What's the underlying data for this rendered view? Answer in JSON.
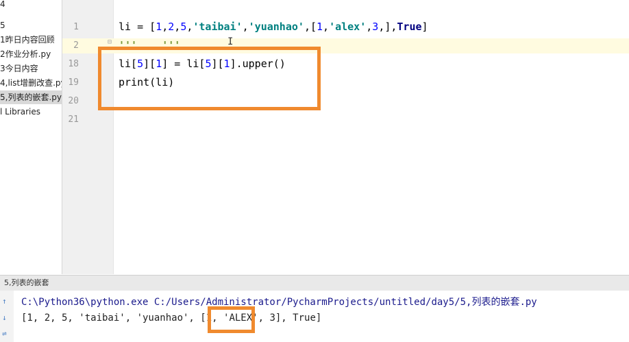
{
  "sidebar": {
    "items": [
      {
        "label": "4"
      },
      {
        "label": "5"
      },
      {
        "label": "1昨日内容回顾"
      },
      {
        "label": "2作业分析.py"
      },
      {
        "label": "3今日内容"
      },
      {
        "label": "4,list增删改查.py"
      },
      {
        "label": "5,列表的嵌套.py"
      },
      {
        "label": "l Libraries"
      }
    ]
  },
  "editor": {
    "line_numbers": [
      "1",
      "2",
      "18",
      "19",
      "20",
      "21"
    ],
    "line1": {
      "p1": "li = [",
      "p2": "1",
      "p3": ",",
      "p4": "2",
      "p5": ",",
      "p6": "5",
      "p7": ",",
      "p8": "'taibai'",
      "p9": ",",
      "p10": "'yuanhao'",
      "p11": ",[",
      "p12": "1",
      "p13": ",",
      "p14": "'alex'",
      "p15": ",",
      "p16": "3",
      "p17": ",],",
      "p18": "True",
      "p19": "]"
    },
    "line2": "'''    '''",
    "line18": {
      "a": "li[",
      "b": "5",
      "c": "][",
      "d": "1",
      "e": "] = li[",
      "f": "5",
      "g": "][",
      "h": "1",
      "i": "].upper()"
    },
    "line19": "print(li)"
  },
  "run_tab": {
    "label": "5,列表的嵌套"
  },
  "console": {
    "command": "C:\\Python36\\python.exe C:/Users/Administrator/PycharmProjects/untitled/day5/5,列表的嵌套.py",
    "output_before": "[1, 2, 5, 'taibai', 'yuanhao', [1, ",
    "output_alex": "'ALEX'",
    "output_after": ", 3], True]"
  },
  "colors": {
    "highlight_box": "#f08a2e",
    "string": "#008080",
    "keyword": "#000080",
    "number": "#0000ff"
  }
}
